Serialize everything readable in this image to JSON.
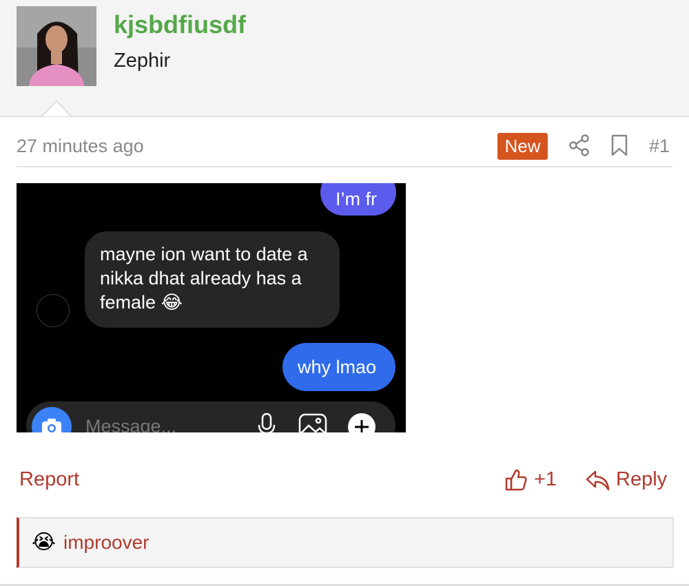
{
  "post": {
    "author": {
      "username": "kjsbdfiusdf",
      "title": "Zephir"
    },
    "timestamp": "27 minutes ago",
    "badge": "New",
    "post_number": "#1",
    "attachment": {
      "messages": [
        {
          "text": "I’m fr",
          "side": "right",
          "color": "#5b5bec"
        },
        {
          "lines": [
            "mayne ion want to date a",
            "nikka dhat already has a",
            "female 😂"
          ],
          "side": "left",
          "color": "#262626"
        },
        {
          "text": "why lmao",
          "side": "right",
          "color": "#2f6bea"
        }
      ],
      "composer_placeholder": "Message..."
    },
    "actions": {
      "report": "Report",
      "like_count": "+1",
      "reply": "Reply"
    },
    "reactions": [
      {
        "emoji": "😭",
        "user": "improover"
      }
    ]
  },
  "colors": {
    "username": "#55a84a",
    "badge": "#d4551e",
    "action": "#b03a2e"
  },
  "icons": [
    "share-icon",
    "bookmark-icon",
    "thumbs-up-icon",
    "reply-icon",
    "camera-icon",
    "microphone-icon",
    "gallery-icon",
    "plus-icon"
  ]
}
